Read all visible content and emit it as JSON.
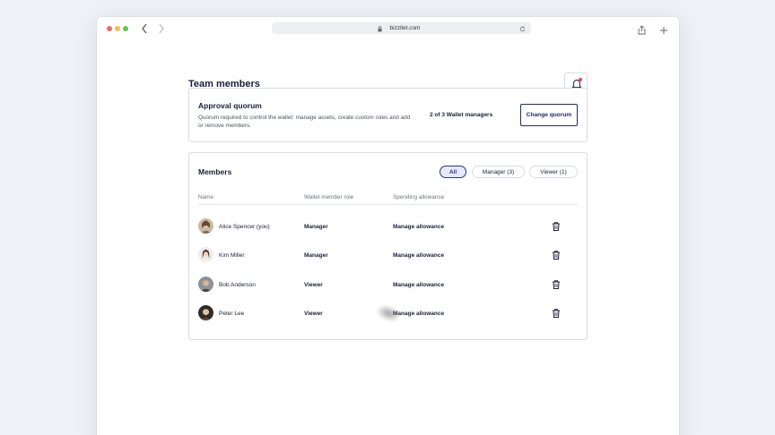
{
  "browser": {
    "url": "bizzllet.com"
  },
  "page": {
    "title": "Team members"
  },
  "quorum": {
    "title": "Approval quorum",
    "description": "Quorum required to control the wallet: manage assets, create custom rules and add or remove members.",
    "count": "2 of 3 Wallet managers",
    "button_label": "Change quorum"
  },
  "members": {
    "title": "Members",
    "filters": [
      {
        "label": "All",
        "active": true
      },
      {
        "label": "Manager (3)",
        "active": false
      },
      {
        "label": "Viewer (1)",
        "active": false
      }
    ],
    "columns": [
      "Name",
      "Wallet member role",
      "Spending allowance"
    ],
    "rows": [
      {
        "name": "Alice Spencer (you)",
        "role": "Manager",
        "allowance": "Manage allowance"
      },
      {
        "name": "Kim Miller",
        "role": "Manager",
        "allowance": "Manage allowance"
      },
      {
        "name": "Bob Anderson",
        "role": "Viewer",
        "allowance": "Manage allowance"
      },
      {
        "name": "Peter Lee",
        "role": "Viewer",
        "allowance": "Manage allowance"
      }
    ]
  },
  "icons": {
    "bell": "bell-icon",
    "trash": "trash-icon",
    "lock": "lock-icon",
    "reload": "reload-icon",
    "share": "share-icon",
    "plus": "plus-icon"
  },
  "colors": {
    "accent": "#2a3489",
    "notification": "#e5484d"
  }
}
